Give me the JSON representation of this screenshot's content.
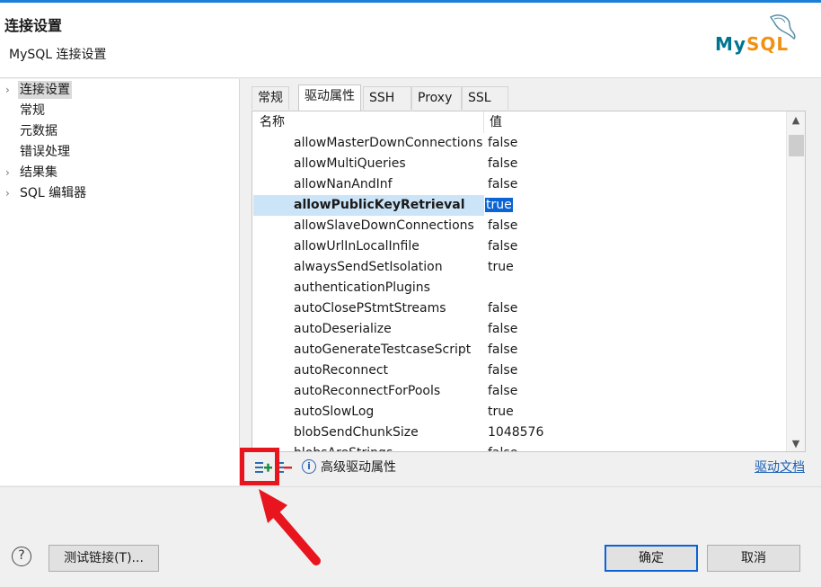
{
  "header": {
    "title": "连接设置",
    "subtitle": "MySQL 连接设置",
    "logo": {
      "my": "My",
      "sql": "SQL",
      "colors": {
        "my": "#00758f",
        "sql": "#f29111"
      }
    }
  },
  "tree": {
    "items": [
      {
        "label": "连接设置",
        "expandable": true,
        "selected": true
      },
      {
        "label": "常规"
      },
      {
        "label": "元数据"
      },
      {
        "label": "错误处理"
      },
      {
        "label": "结果集",
        "expandable": true
      },
      {
        "label": "SQL 编辑器",
        "expandable": true
      }
    ]
  },
  "tabs": [
    {
      "label": "常规"
    },
    {
      "label": "驱动属性",
      "active": true
    },
    {
      "label": "SSH"
    },
    {
      "label": "Proxy"
    },
    {
      "label": "SSL"
    }
  ],
  "table": {
    "columns": {
      "name": "名称",
      "value": "值"
    },
    "rows": [
      {
        "name": "allowMasterDownConnections",
        "value": "false"
      },
      {
        "name": "allowMultiQueries",
        "value": "false"
      },
      {
        "name": "allowNanAndInf",
        "value": "false"
      },
      {
        "name": "allowPublicKeyRetrieval",
        "value": "true",
        "selected": true
      },
      {
        "name": "allowSlaveDownConnections",
        "value": "false"
      },
      {
        "name": "allowUrlInLocalInfile",
        "value": "false"
      },
      {
        "name": "alwaysSendSetIsolation",
        "value": "true"
      },
      {
        "name": "authenticationPlugins",
        "value": ""
      },
      {
        "name": "autoClosePStmtStreams",
        "value": "false"
      },
      {
        "name": "autoDeserialize",
        "value": "false"
      },
      {
        "name": "autoGenerateTestcaseScript",
        "value": "false"
      },
      {
        "name": "autoReconnect",
        "value": "false"
      },
      {
        "name": "autoReconnectForPools",
        "value": "false"
      },
      {
        "name": "autoSlowLog",
        "value": "true"
      },
      {
        "name": "blobSendChunkSize",
        "value": "1048576"
      },
      {
        "name": "blobsAreStrings",
        "value": "false"
      }
    ]
  },
  "toolbar": {
    "info_glyph": "i",
    "advanced_label": "高级驱动属性",
    "doc_link": "驱动文档"
  },
  "footer": {
    "help_glyph": "?",
    "test_button": "测试链接(T)...",
    "ok_button": "确定",
    "cancel_button": "取消"
  },
  "colors": {
    "accent": "#0a64d6",
    "selection": "#cce4f7",
    "annotation": "#e8141e",
    "add_icon": "#1a8a3c",
    "remove_icon": "#d9262c"
  }
}
